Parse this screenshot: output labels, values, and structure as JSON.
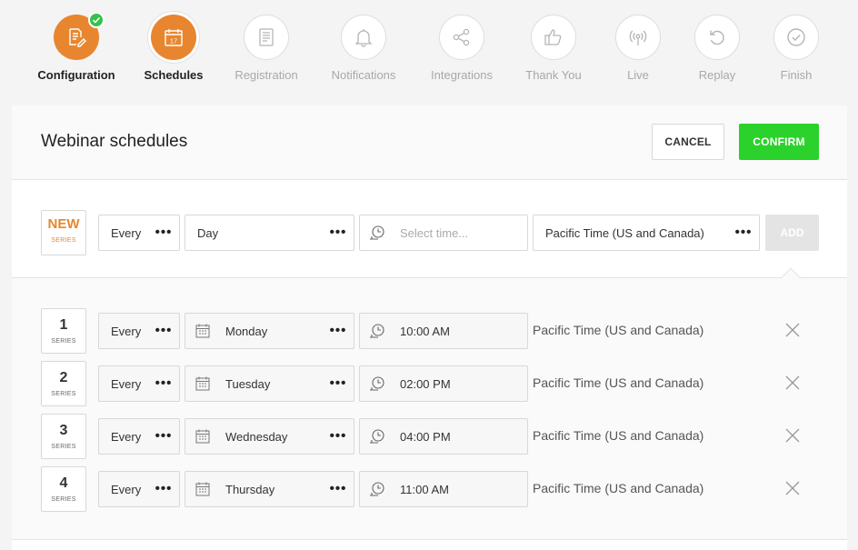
{
  "steps": [
    {
      "label": "Configuration",
      "icon": "edit-document-icon",
      "state": "done"
    },
    {
      "label": "Schedules",
      "icon": "calendar-icon",
      "state": "current",
      "calendar_day": "17"
    },
    {
      "label": "Registration",
      "icon": "form-icon",
      "state": "pending"
    },
    {
      "label": "Notifications",
      "icon": "bell-icon",
      "state": "pending"
    },
    {
      "label": "Integrations",
      "icon": "share-icon",
      "state": "pending"
    },
    {
      "label": "Thank You",
      "icon": "thumbs-up-icon",
      "state": "pending"
    },
    {
      "label": "Live",
      "icon": "broadcast-icon",
      "state": "pending"
    },
    {
      "label": "Replay",
      "icon": "replay-icon",
      "state": "pending"
    },
    {
      "label": "Finish",
      "icon": "check-circle-icon",
      "state": "pending"
    }
  ],
  "header": {
    "title": "Webinar schedules",
    "cancel_label": "CANCEL",
    "confirm_label": "CONFIRM"
  },
  "new_series": {
    "badge_top": "NEW",
    "badge_sub": "SERIES",
    "frequency": "Every",
    "period": "Day",
    "time_placeholder": "Select time...",
    "timezone": "Pacific Time (US and Canada)",
    "add_label": "ADD"
  },
  "series": [
    {
      "num": "1",
      "sub": "SERIES",
      "frequency": "Every",
      "day": "Monday",
      "time": "10:00 AM",
      "timezone": "Pacific Time (US and Canada)"
    },
    {
      "num": "2",
      "sub": "SERIES",
      "frequency": "Every",
      "day": "Tuesday",
      "time": "02:00 PM",
      "timezone": "Pacific Time (US and Canada)"
    },
    {
      "num": "3",
      "sub": "SERIES",
      "frequency": "Every",
      "day": "Wednesday",
      "time": "04:00 PM",
      "timezone": "Pacific Time (US and Canada)"
    },
    {
      "num": "4",
      "sub": "SERIES",
      "frequency": "Every",
      "day": "Thursday",
      "time": "11:00 AM",
      "timezone": "Pacific Time (US and Canada)"
    }
  ],
  "colors": {
    "accent": "#e8862f",
    "confirm": "#2bd22b",
    "done_badge": "#36c24a",
    "disabled": "#e4e4e4"
  }
}
